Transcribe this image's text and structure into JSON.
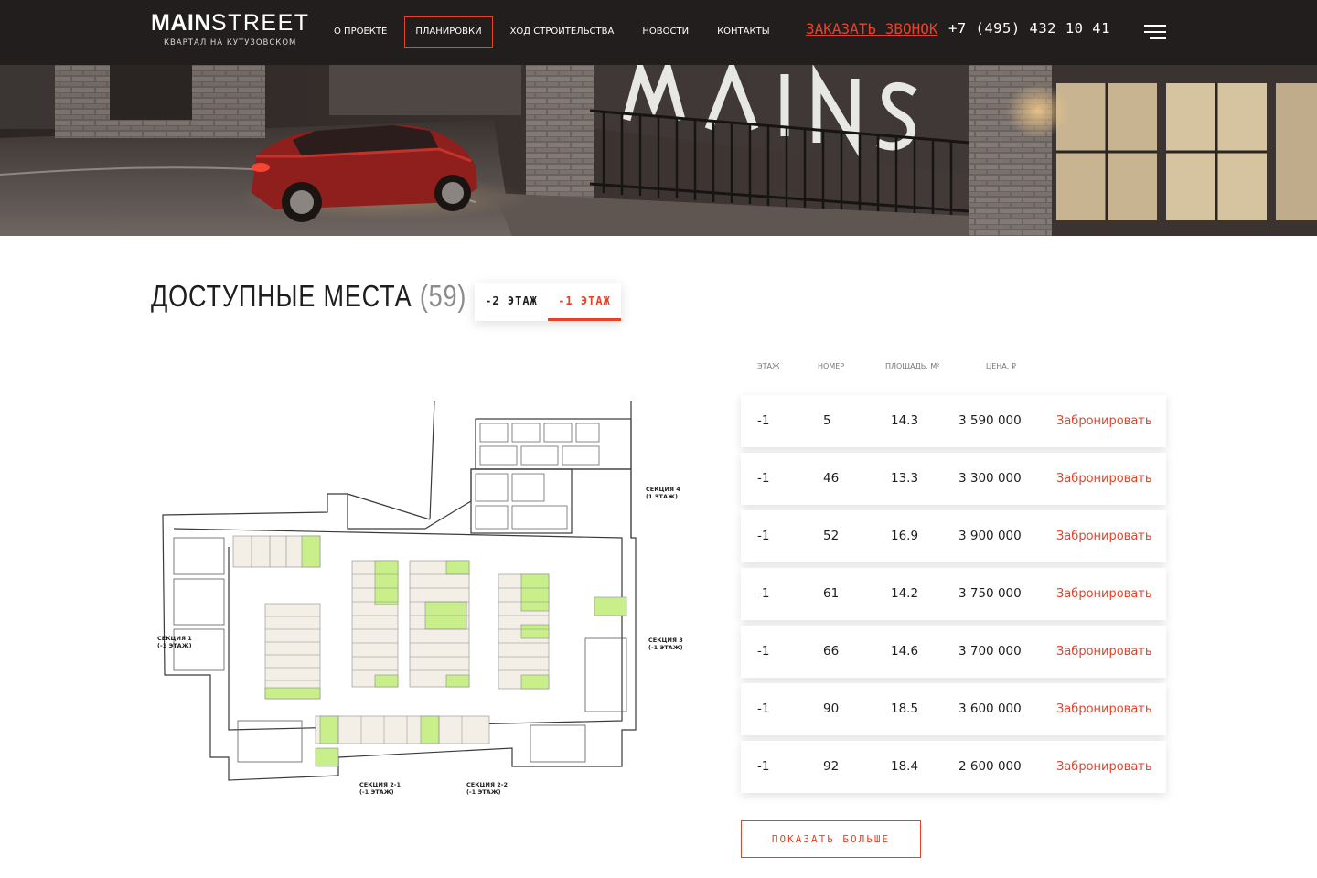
{
  "header": {
    "logo_bold": "MAIN",
    "logo_light": "STREET",
    "logo_sub": "КВАРТАЛ НА КУТУЗОВСКОМ",
    "nav": [
      {
        "label": "О ПРОЕКТЕ",
        "active": false
      },
      {
        "label": "ПЛАНИРОВКИ",
        "active": true
      },
      {
        "label": "ХОД СТРОИТЕЛЬСТВА",
        "active": false
      },
      {
        "label": "НОВОСТИ",
        "active": false
      },
      {
        "label": "КОНТАКТЫ",
        "active": false
      }
    ],
    "callback": "ЗАКАЗАТЬ ЗВОНОК",
    "phone": "+7 (495) 432 10 41",
    "menu_icon": "hamburger-icon"
  },
  "section": {
    "title": "ДОСТУПНЫЕ МЕСТА",
    "count": "(59)",
    "floors": [
      {
        "label": "-2 ЭТАЖ",
        "active": false
      },
      {
        "label": "-1 ЭТАЖ",
        "active": true
      }
    ]
  },
  "plan": {
    "labels": {
      "s4": "СЕКЦИЯ 4",
      "s4b": "(1 ЭТАЖ)",
      "s1": "СЕКЦИЯ 1",
      "s1b": "(-1 ЭТАЖ)",
      "s3": "СЕКЦИЯ 3",
      "s3b": "(-1 ЭТАЖ)",
      "s21": "СЕКЦИЯ 2-1",
      "s21b": "(-1 ЭТАЖ)",
      "s22": "СЕКЦИЯ 2-2",
      "s22b": "(-1 ЭТАЖ)"
    }
  },
  "table": {
    "headers": {
      "floor": "ЭТАЖ",
      "number": "НОМЕР",
      "area": "ПЛОЩАДЬ, М²",
      "price": "ЦЕНА, ₽"
    },
    "book_label": "Забронировать",
    "rows": [
      {
        "floor": "-1",
        "number": "5",
        "area": "14.3",
        "price": "3 590 000"
      },
      {
        "floor": "-1",
        "number": "46",
        "area": "13.3",
        "price": "3 300 000"
      },
      {
        "floor": "-1",
        "number": "52",
        "area": "16.9",
        "price": "3 900 000"
      },
      {
        "floor": "-1",
        "number": "61",
        "area": "14.2",
        "price": "3 750 000"
      },
      {
        "floor": "-1",
        "number": "66",
        "area": "14.6",
        "price": "3 700 000"
      },
      {
        "floor": "-1",
        "number": "90",
        "area": "18.5",
        "price": "3 600 000"
      },
      {
        "floor": "-1",
        "number": "92",
        "area": "18.4",
        "price": "2 600 000"
      }
    ],
    "more_label": "ПОКАЗАТЬ БОЛЬШЕ"
  },
  "colors": {
    "accent": "#e4432a",
    "header_bg": "#221e1d",
    "available_spot": "#c9ef8a"
  }
}
